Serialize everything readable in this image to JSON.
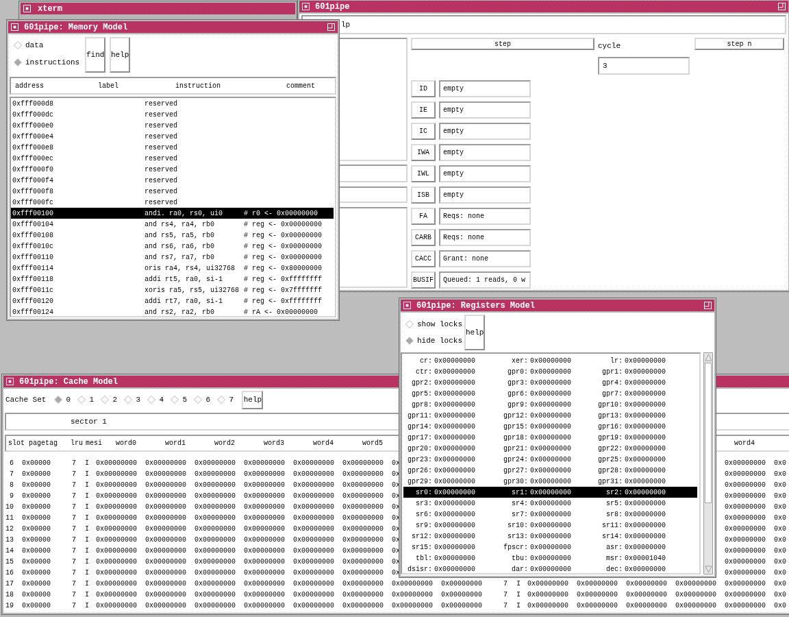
{
  "xterm": {
    "title": "xterm"
  },
  "main_window": {
    "title": "601pipe",
    "menu": [
      "lp"
    ],
    "step_button": "step",
    "cycle_label": "cycle",
    "cycle_value": "3",
    "step_n_button": "step n",
    "stages": [
      {
        "name": "ID",
        "value": "empty"
      },
      {
        "name": "IE",
        "value": "empty"
      },
      {
        "name": "IC",
        "value": "empty"
      },
      {
        "name": "IWA",
        "value": "empty"
      },
      {
        "name": "IWL",
        "value": "empty"
      },
      {
        "name": "ISB",
        "value": "empty"
      },
      {
        "name": "FA",
        "value": "Reqs: none"
      },
      {
        "name": "CARB",
        "value": "Reqs: none"
      },
      {
        "name": "CACC",
        "value": "Grant: none"
      },
      {
        "name": "BUSIF",
        "value": "Queued: 1 reads, 0 w"
      }
    ]
  },
  "memory_window": {
    "title": "601pipe: Memory Model",
    "view_options": [
      {
        "label": "data",
        "selected": false
      },
      {
        "label": "instructions",
        "selected": true
      }
    ],
    "buttons": [
      "find",
      "help"
    ],
    "columns": [
      "address",
      "label",
      "instruction",
      "comment"
    ],
    "rows": [
      {
        "address": "0xfff000d8",
        "instruction": "reserved",
        "selected": false
      },
      {
        "address": "0xfff000dc",
        "instruction": "reserved",
        "selected": false
      },
      {
        "address": "0xfff000e0",
        "instruction": "reserved",
        "selected": false
      },
      {
        "address": "0xfff000e4",
        "instruction": "reserved",
        "selected": false
      },
      {
        "address": "0xfff000e8",
        "instruction": "reserved",
        "selected": false
      },
      {
        "address": "0xfff000ec",
        "instruction": "reserved",
        "selected": false
      },
      {
        "address": "0xfff000f0",
        "instruction": "reserved",
        "selected": false
      },
      {
        "address": "0xfff000f4",
        "instruction": "reserved",
        "selected": false
      },
      {
        "address": "0xfff000f8",
        "instruction": "reserved",
        "selected": false
      },
      {
        "address": "0xfff000fc",
        "instruction": "reserved",
        "selected": false
      },
      {
        "address": "0xfff00100",
        "instruction": "andi. ra0, rs0, ui0",
        "comment": "# r0 <- 0x00000000",
        "selected": true
      },
      {
        "address": "0xfff00104",
        "instruction": "and rs4, ra4, rb0",
        "comment": "# reg <- 0x00000000",
        "selected": false
      },
      {
        "address": "0xfff00108",
        "instruction": "and rs5, ra5, rb0",
        "comment": "# reg <- 0x00000000",
        "selected": false
      },
      {
        "address": "0xfff0010c",
        "instruction": "and rs6, ra6, rb0",
        "comment": "# reg <- 0x00000000",
        "selected": false
      },
      {
        "address": "0xfff00110",
        "instruction": "and rs7, ra7, rb0",
        "comment": "# reg <- 0x00000000",
        "selected": false
      },
      {
        "address": "0xfff00114",
        "instruction": "oris ra4, rs4, ui32768",
        "comment": "# reg <- 0x80000000",
        "selected": false
      },
      {
        "address": "0xfff00118",
        "instruction": "addi rt5, ra0, si-1",
        "comment": "# reg <- 0xffffffff",
        "selected": false
      },
      {
        "address": "0xfff0011c",
        "instruction": "xoris ra5, rs5, ui32768",
        "comment": "# reg <- 0x7fffffff",
        "selected": false
      },
      {
        "address": "0xfff00120",
        "instruction": "addi rt7, ra0, si-1",
        "comment": "# reg <- 0xffffffff",
        "selected": false
      },
      {
        "address": "0xfff00124",
        "instruction": "and rs2, ra2, rb0",
        "comment": "# rA <- 0x00000000",
        "selected": false
      }
    ]
  },
  "cache_window": {
    "title": "601pipe: Cache Model",
    "set_label": "Cache Set",
    "sets": [
      {
        "label": "0",
        "selected": true
      },
      {
        "label": "1",
        "selected": false
      },
      {
        "label": "2",
        "selected": false
      },
      {
        "label": "3",
        "selected": false
      },
      {
        "label": "4",
        "selected": false
      },
      {
        "label": "5",
        "selected": false
      },
      {
        "label": "6",
        "selected": false
      },
      {
        "label": "7",
        "selected": false
      }
    ],
    "help_button": "help",
    "sector": "sector 1",
    "columns": [
      "slot",
      "pagetag",
      "lru",
      "mesi",
      "word0",
      "word1",
      "word2",
      "word3",
      "word4",
      "word5"
    ],
    "tail_columns": [
      "word4"
    ],
    "rows": [
      {
        "cells": [
          "6",
          "0x00000",
          "7",
          "I",
          "0x00000000",
          "0x00000000",
          "0x00000000",
          "0x00000000",
          "0x00000000",
          "0x00000000",
          "0x"
        ],
        "tail": [
          "0x00000000",
          "0x0"
        ]
      },
      {
        "cells": [
          "7",
          "0x00000",
          "7",
          "I",
          "0x00000000",
          "0x00000000",
          "0x00000000",
          "0x00000000",
          "0x00000000",
          "0x00000000",
          "0x"
        ],
        "tail": [
          "0x00000000",
          "0x0"
        ]
      },
      {
        "cells": [
          "8",
          "0x00000",
          "7",
          "I",
          "0x00000000",
          "0x00000000",
          "0x00000000",
          "0x00000000",
          "0x00000000",
          "0x00000000",
          "0x"
        ],
        "tail": [
          "0x00000000",
          "0x0"
        ]
      },
      {
        "cells": [
          "9",
          "0x00000",
          "7",
          "I",
          "0x00000000",
          "0x00000000",
          "0x00000000",
          "0x00000000",
          "0x00000000",
          "0x00000000",
          "0x"
        ],
        "tail": [
          "0x00000000",
          "0x0"
        ]
      },
      {
        "cells": [
          "10",
          "0x00000",
          "7",
          "I",
          "0x00000000",
          "0x00000000",
          "0x00000000",
          "0x00000000",
          "0x00000000",
          "0x00000000",
          "0x"
        ],
        "tail": [
          "0x00000000",
          "0x0"
        ]
      },
      {
        "cells": [
          "11",
          "0x00000",
          "7",
          "I",
          "0x00000000",
          "0x00000000",
          "0x00000000",
          "0x00000000",
          "0x00000000",
          "0x00000000",
          "0x"
        ],
        "tail": [
          "0x00000000",
          "0x0"
        ]
      },
      {
        "cells": [
          "12",
          "0x00000",
          "7",
          "I",
          "0x00000000",
          "0x00000000",
          "0x00000000",
          "0x00000000",
          "0x00000000",
          "0x00000000",
          "0x"
        ],
        "tail": [
          "0x00000000",
          "0x0"
        ]
      },
      {
        "cells": [
          "13",
          "0x00000",
          "7",
          "I",
          "0x00000000",
          "0x00000000",
          "0x00000000",
          "0x00000000",
          "0x00000000",
          "0x00000000",
          "0x"
        ],
        "tail": [
          "0x00000000",
          "0x0"
        ]
      },
      {
        "cells": [
          "14",
          "0x00000",
          "7",
          "I",
          "0x00000000",
          "0x00000000",
          "0x00000000",
          "0x00000000",
          "0x00000000",
          "0x00000000",
          "0x"
        ],
        "tail": [
          "0x00000000",
          "0x0"
        ]
      },
      {
        "cells": [
          "15",
          "0x00000",
          "7",
          "I",
          "0x00000000",
          "0x00000000",
          "0x00000000",
          "0x00000000",
          "0x00000000",
          "0x00000000",
          "0x"
        ],
        "tail": [
          "0x00000000",
          "0x0"
        ]
      },
      {
        "cells": [
          "16",
          "0x00000",
          "7",
          "I",
          "0x00000000",
          "0x00000000",
          "0x00000000",
          "0x00000000",
          "0x00000000",
          "0x00000000",
          "0x"
        ],
        "tail": [
          "0x00000000",
          "0x0"
        ]
      },
      {
        "cells": [
          "17",
          "0x00000",
          "7",
          "I",
          "0x00000000",
          "0x00000000",
          "0x00000000",
          "0x00000000",
          "0x00000000",
          "0x00000000",
          "0x00000000",
          "0x00000000",
          "7",
          "I",
          "0x00000000",
          "0x00000000",
          "0x00000000",
          "0x00000000",
          "0x00000000",
          "0x0"
        ]
      },
      {
        "cells": [
          "18",
          "0x00000",
          "7",
          "I",
          "0x00000000",
          "0x00000000",
          "0x00000000",
          "0x00000000",
          "0x00000000",
          "0x00000000",
          "0x00000000",
          "0x00000000",
          "7",
          "I",
          "0x00000000",
          "0x00000000",
          "0x00000000",
          "0x00000000",
          "0x00000000",
          "0x0"
        ]
      },
      {
        "cells": [
          "19",
          "0x00000",
          "7",
          "I",
          "0x00000000",
          "0x00000000",
          "0x00000000",
          "0x00000000",
          "0x00000000",
          "0x00000000",
          "0x00000000",
          "0x00000000",
          "7",
          "I",
          "0x00000000",
          "0x00000000",
          "0x00000000",
          "0x00000000",
          "0x00000000",
          "0x0"
        ]
      }
    ]
  },
  "registers_window": {
    "title": "601pipe: Registers Model",
    "lock_options": [
      {
        "label": "show locks",
        "selected": false
      },
      {
        "label": "hide locks",
        "selected": true
      }
    ],
    "help_button": "help",
    "rows": [
      {
        "selected": false,
        "registers": [
          {
            "name": "cr:",
            "value": "0x00000000"
          },
          {
            "name": "xer:",
            "value": "0x00000000"
          },
          {
            "name": "lr:",
            "value": "0x00000000"
          }
        ]
      },
      {
        "selected": false,
        "registers": [
          {
            "name": "ctr:",
            "value": "0x00000000"
          },
          {
            "name": "gpr0:",
            "value": "0x00000000"
          },
          {
            "name": "gpr1:",
            "value": "0x00000000"
          }
        ]
      },
      {
        "selected": false,
        "registers": [
          {
            "name": "gpr2:",
            "value": "0x00000000"
          },
          {
            "name": "gpr3:",
            "value": "0x00000000"
          },
          {
            "name": "gpr4:",
            "value": "0x00000000"
          }
        ]
      },
      {
        "selected": false,
        "registers": [
          {
            "name": "gpr5:",
            "value": "0x00000000"
          },
          {
            "name": "gpr6:",
            "value": "0x00000000"
          },
          {
            "name": "gpr7:",
            "value": "0x00000000"
          }
        ]
      },
      {
        "selected": false,
        "registers": [
          {
            "name": "gpr8:",
            "value": "0x00000000"
          },
          {
            "name": "gpr9:",
            "value": "0x00000000"
          },
          {
            "name": "gpr10:",
            "value": "0x00000000"
          }
        ]
      },
      {
        "selected": false,
        "registers": [
          {
            "name": "gpr11:",
            "value": "0x00000000"
          },
          {
            "name": "gpr12:",
            "value": "0x00000000"
          },
          {
            "name": "gpr13:",
            "value": "0x00000000"
          }
        ]
      },
      {
        "selected": false,
        "registers": [
          {
            "name": "gpr14:",
            "value": "0x00000000"
          },
          {
            "name": "gpr15:",
            "value": "0x00000000"
          },
          {
            "name": "gpr16:",
            "value": "0x00000000"
          }
        ]
      },
      {
        "selected": false,
        "registers": [
          {
            "name": "gpr17:",
            "value": "0x00000000"
          },
          {
            "name": "gpr18:",
            "value": "0x00000000"
          },
          {
            "name": "gpr19:",
            "value": "0x00000000"
          }
        ]
      },
      {
        "selected": false,
        "registers": [
          {
            "name": "gpr20:",
            "value": "0x00000000"
          },
          {
            "name": "gpr21:",
            "value": "0x00000000"
          },
          {
            "name": "gpr22:",
            "value": "0x00000000"
          }
        ]
      },
      {
        "selected": false,
        "registers": [
          {
            "name": "gpr23:",
            "value": "0x00000000"
          },
          {
            "name": "gpr24:",
            "value": "0x00000000"
          },
          {
            "name": "gpr25:",
            "value": "0x00000000"
          }
        ]
      },
      {
        "selected": false,
        "registers": [
          {
            "name": "gpr26:",
            "value": "0x00000000"
          },
          {
            "name": "gpr27:",
            "value": "0x00000000"
          },
          {
            "name": "gpr28:",
            "value": "0x00000000"
          }
        ]
      },
      {
        "selected": false,
        "registers": [
          {
            "name": "gpr29:",
            "value": "0x00000000"
          },
          {
            "name": "gpr30:",
            "value": "0x00000000"
          },
          {
            "name": "gpr31:",
            "value": "0x00000000"
          }
        ]
      },
      {
        "selected": true,
        "registers": [
          {
            "name": "sr0:",
            "value": "0x00000000"
          },
          {
            "name": "sr1:",
            "value": "0x00000000"
          },
          {
            "name": "sr2:",
            "value": "0x00000000"
          }
        ]
      },
      {
        "selected": false,
        "registers": [
          {
            "name": "sr3:",
            "value": "0x00000000"
          },
          {
            "name": "sr4:",
            "value": "0x00000000"
          },
          {
            "name": "sr5:",
            "value": "0x00000000"
          }
        ]
      },
      {
        "selected": false,
        "registers": [
          {
            "name": "sr6:",
            "value": "0x00000000"
          },
          {
            "name": "sr7:",
            "value": "0x00000000"
          },
          {
            "name": "sr8:",
            "value": "0x00000000"
          }
        ]
      },
      {
        "selected": false,
        "registers": [
          {
            "name": "sr9:",
            "value": "0x00000000"
          },
          {
            "name": "sr10:",
            "value": "0x00000000"
          },
          {
            "name": "sr11:",
            "value": "0x00000000"
          }
        ]
      },
      {
        "selected": false,
        "registers": [
          {
            "name": "sr12:",
            "value": "0x00000000"
          },
          {
            "name": "sr13:",
            "value": "0x00000000"
          },
          {
            "name": "sr14:",
            "value": "0x00000000"
          }
        ]
      },
      {
        "selected": false,
        "registers": [
          {
            "name": "sr15:",
            "value": "0x00000000"
          },
          {
            "name": "fpscr:",
            "value": "0x00000000"
          },
          {
            "name": "asr:",
            "value": "0x00000000"
          }
        ]
      },
      {
        "selected": false,
        "registers": [
          {
            "name": "tbl:",
            "value": "0x00000000"
          },
          {
            "name": "tbu:",
            "value": "0x00000000"
          },
          {
            "name": "msr:",
            "value": "0x00001040"
          }
        ]
      },
      {
        "selected": false,
        "registers": [
          {
            "name": "dsisr:",
            "value": "0x00000000"
          },
          {
            "name": "dar:",
            "value": "0x00000000"
          },
          {
            "name": "dec:",
            "value": "0x00000000"
          }
        ]
      }
    ]
  }
}
